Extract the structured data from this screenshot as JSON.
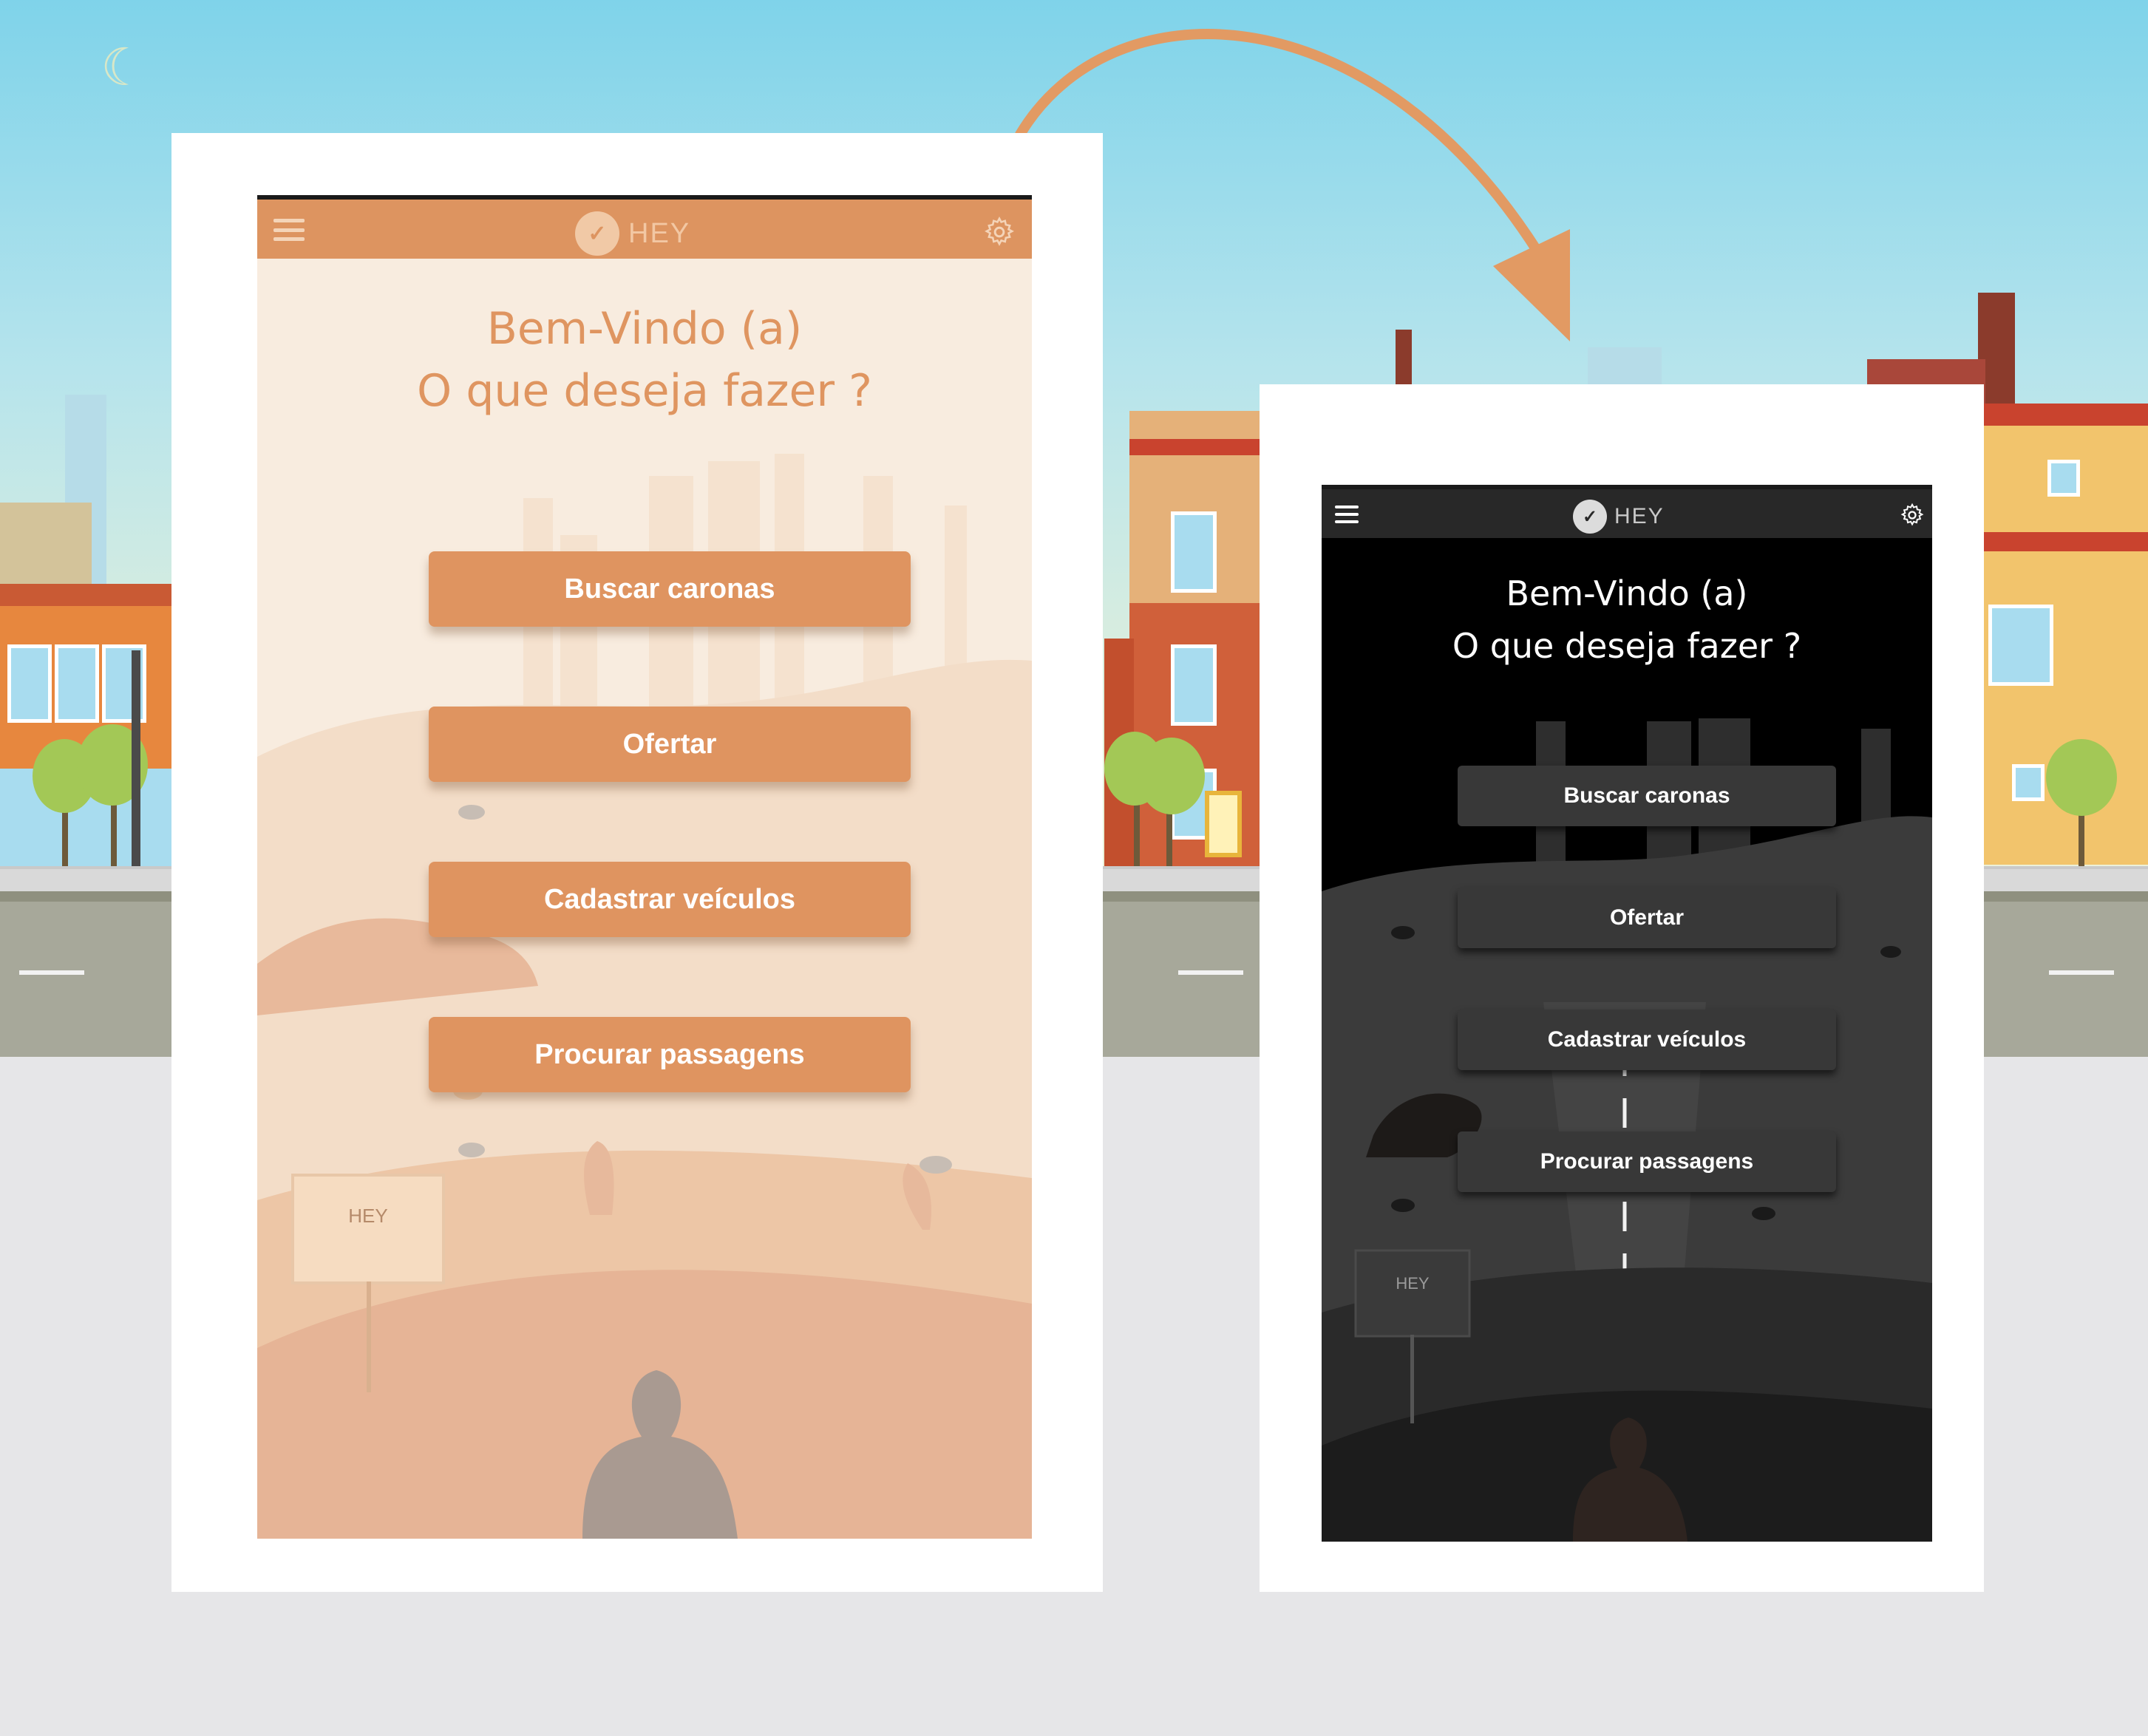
{
  "light_screen": {
    "app_name": "HEY",
    "welcome_line1": "Bem-Vindo (a)",
    "welcome_line2": "O que deseja fazer ?",
    "buttons": [
      "Buscar caronas",
      "Ofertar",
      "Cadastrar veículos",
      "Procurar passagens"
    ],
    "sign_text": "HEY",
    "colors": {
      "appbar": "#dd9460",
      "background": "#f8ecdf",
      "button": "#df9460",
      "text": "#df9560"
    }
  },
  "dark_screen": {
    "app_name": "HEY",
    "welcome_line1": "Bem-Vindo (a)",
    "welcome_line2": "O que deseja fazer ?",
    "buttons": [
      "Buscar caronas",
      "Ofertar",
      "Cadastrar veículos",
      "Procurar passagens"
    ],
    "sign_text": "HEY",
    "colors": {
      "appbar": "#282828",
      "background": "#000000",
      "button": "#383838",
      "text": "#ffffff"
    }
  },
  "icons": {
    "menu": "hamburger-menu-icon",
    "settings": "gear-icon",
    "logo": "hey-logo-icon",
    "transition": "curved-arrow-icon"
  },
  "colors": {
    "arrow": "#e29a63",
    "sky_top": "#7fd3ea",
    "road": "#a7a89a"
  }
}
